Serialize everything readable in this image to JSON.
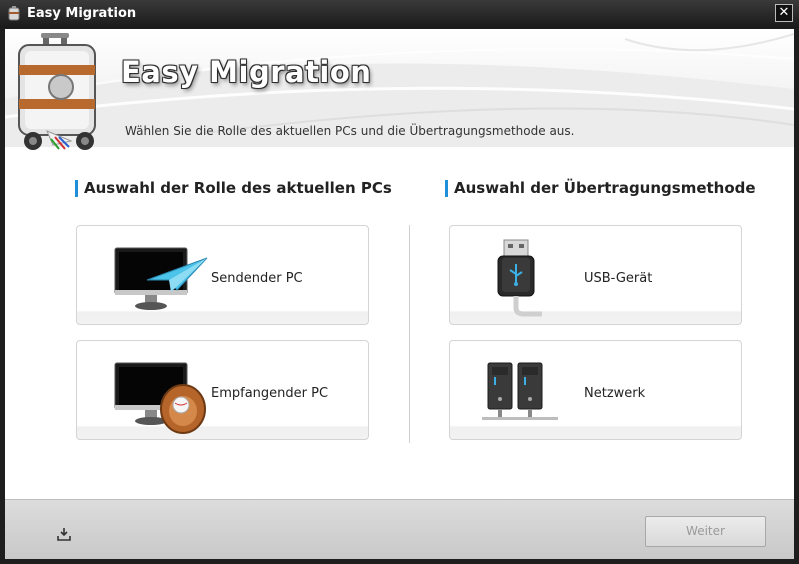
{
  "window": {
    "title": "Easy Migration",
    "close_label": "✕"
  },
  "header": {
    "app_title": "Easy Migration",
    "subtitle": "Wählen Sie die Rolle des aktuellen PCs und die Übertragungsmethode aus."
  },
  "left_section": {
    "title": "Auswahl der Rolle des aktuellen PCs",
    "options": [
      {
        "label": "Sendender PC",
        "icon": "monitor-paper-plane-icon"
      },
      {
        "label": "Empfangender PC",
        "icon": "monitor-baseball-glove-icon"
      }
    ]
  },
  "right_section": {
    "title": "Auswahl der Übertragungsmethode",
    "options": [
      {
        "label": "USB-Gerät",
        "icon": "usb-drive-icon"
      },
      {
        "label": "Netzwerk",
        "icon": "network-servers-icon"
      }
    ]
  },
  "footer": {
    "download_icon": "download-icon",
    "next_label": "Weiter",
    "next_enabled": false
  },
  "colors": {
    "accent": "#1f8fd8",
    "titlebar": "#1e1e1e"
  }
}
